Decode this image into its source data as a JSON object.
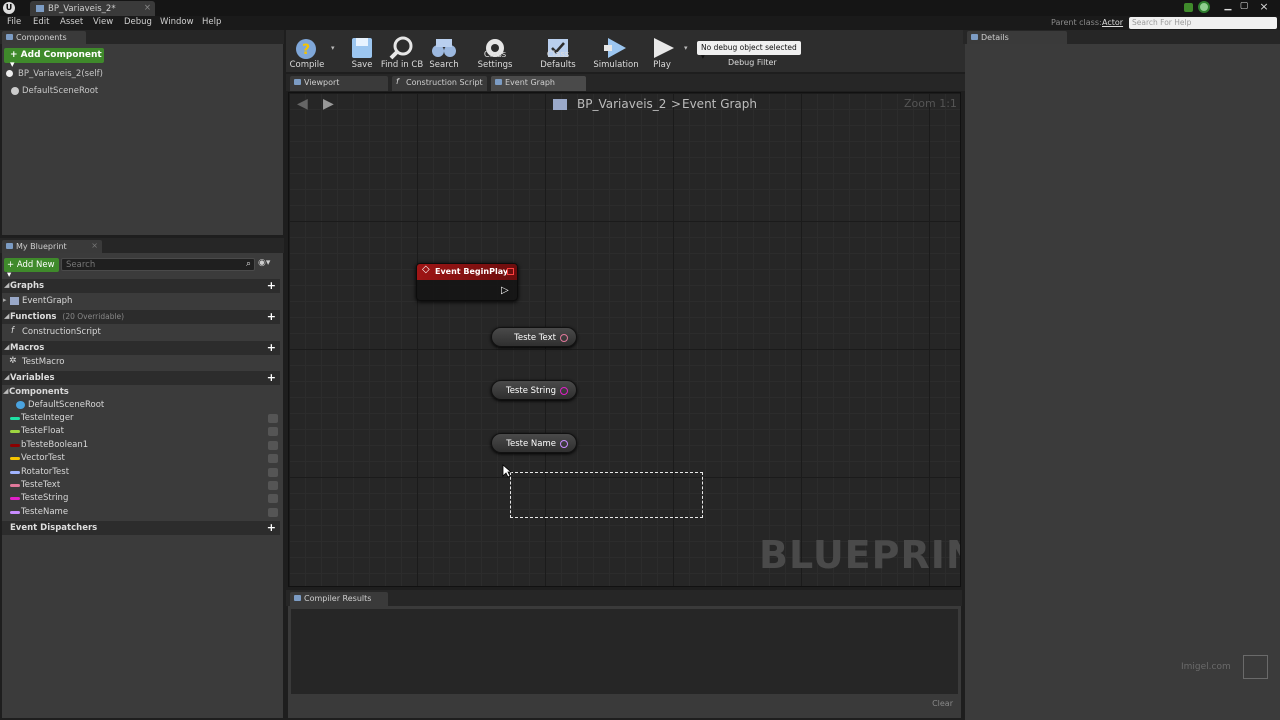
{
  "titlebar": {
    "tab_title": "BP_Variaveis_2*"
  },
  "menu": [
    "File",
    "Edit",
    "Asset",
    "View",
    "Debug",
    "Window",
    "Help"
  ],
  "topright": {
    "parent_class_label": "Parent class:",
    "parent_class_value": "Actor",
    "search_placeholder": "Search For Help"
  },
  "components_panel": {
    "tab": "Components",
    "add_button": "+ Add Component ▾",
    "self_item": "BP_Variaveis_2(self)",
    "root_item": "DefaultSceneRoot"
  },
  "toolbar": {
    "compile": "Compile",
    "save": "Save",
    "find": "Find in CB",
    "search": "Search",
    "class_settings": "Class Settings",
    "class_defaults": "Class Defaults",
    "simulation": "Simulation",
    "play": "Play",
    "debug_select": "No debug object selected ▾",
    "debug_filter": "Debug Filter"
  },
  "editor_tabs": [
    "Viewport",
    "Construction Script",
    "Event Graph"
  ],
  "graph": {
    "breadcrumb_bp": "BP_Variaveis_2",
    "breadcrumb_sep": ">",
    "breadcrumb_graph": "Event Graph",
    "zoom": "Zoom 1:1",
    "watermark": "BLUEPRINT",
    "event_node": "Event BeginPlay",
    "var_nodes": [
      "Teste Text",
      "Teste String",
      "Teste Name"
    ]
  },
  "my_blueprint": {
    "tab": "My Blueprint",
    "add_new": "+ Add New ▾",
    "search_placeholder": "Search",
    "graphs_header": "Graphs",
    "event_graph": "EventGraph",
    "functions_header": "Functions",
    "functions_count": "(20 Overridable)",
    "construction_script": "ConstructionScript",
    "macros_header": "Macros",
    "test_macro": "TestMacro",
    "variables_header": "Variables",
    "components_sub": "Components",
    "default_scene_root": "DefaultSceneRoot",
    "variables": [
      {
        "name": "TesteInteger",
        "color": "#1fe0a4"
      },
      {
        "name": "TesteFloat",
        "color": "#9ed641"
      },
      {
        "name": "bTesteBoolean1",
        "color": "#8b0000"
      },
      {
        "name": "VectorTest",
        "color": "#f5c400"
      },
      {
        "name": "RotatorTest",
        "color": "#a0b4ff"
      },
      {
        "name": "TesteText",
        "color": "#e0789a"
      },
      {
        "name": "TesteString",
        "color": "#e020c8"
      },
      {
        "name": "TesteName",
        "color": "#c88cff"
      }
    ],
    "event_dispatchers": "Event Dispatchers"
  },
  "compiler": {
    "tab": "Compiler Results",
    "clear": "Clear"
  },
  "details": {
    "tab": "Details"
  },
  "watermark_brand": "Imigel.com"
}
